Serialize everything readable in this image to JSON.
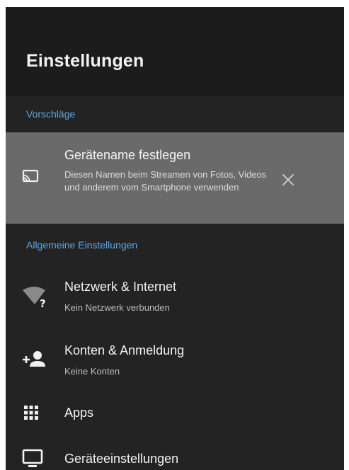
{
  "header": {
    "title": "Einstellungen"
  },
  "suggestions": {
    "header": "Vorschläge",
    "item": {
      "icon": "cast-icon",
      "title": "Gerätename festlegen",
      "description": "Diesen Namen beim Streamen von Fotos, Videos und anderem vom Smartphone verwenden",
      "dismiss_icon": "close-icon"
    }
  },
  "general": {
    "header": "Allgemeine Einstellungen",
    "items": [
      {
        "icon": "wifi-unknown-icon",
        "title": "Netzwerk & Internet",
        "subtitle": "Kein Netzwerk verbunden"
      },
      {
        "icon": "add-account-icon",
        "title": "Konten & Anmeldung",
        "subtitle": "Keine Konten"
      },
      {
        "icon": "apps-grid-icon",
        "title": "Apps",
        "subtitle": ""
      },
      {
        "icon": "monitor-icon",
        "title": "Geräteeinstellungen",
        "subtitle": ""
      }
    ]
  },
  "colors": {
    "accent": "#5ea7e6",
    "background": "#232323",
    "header_background": "#1c1c1c",
    "suggestion_background": "#6a6a6a"
  }
}
